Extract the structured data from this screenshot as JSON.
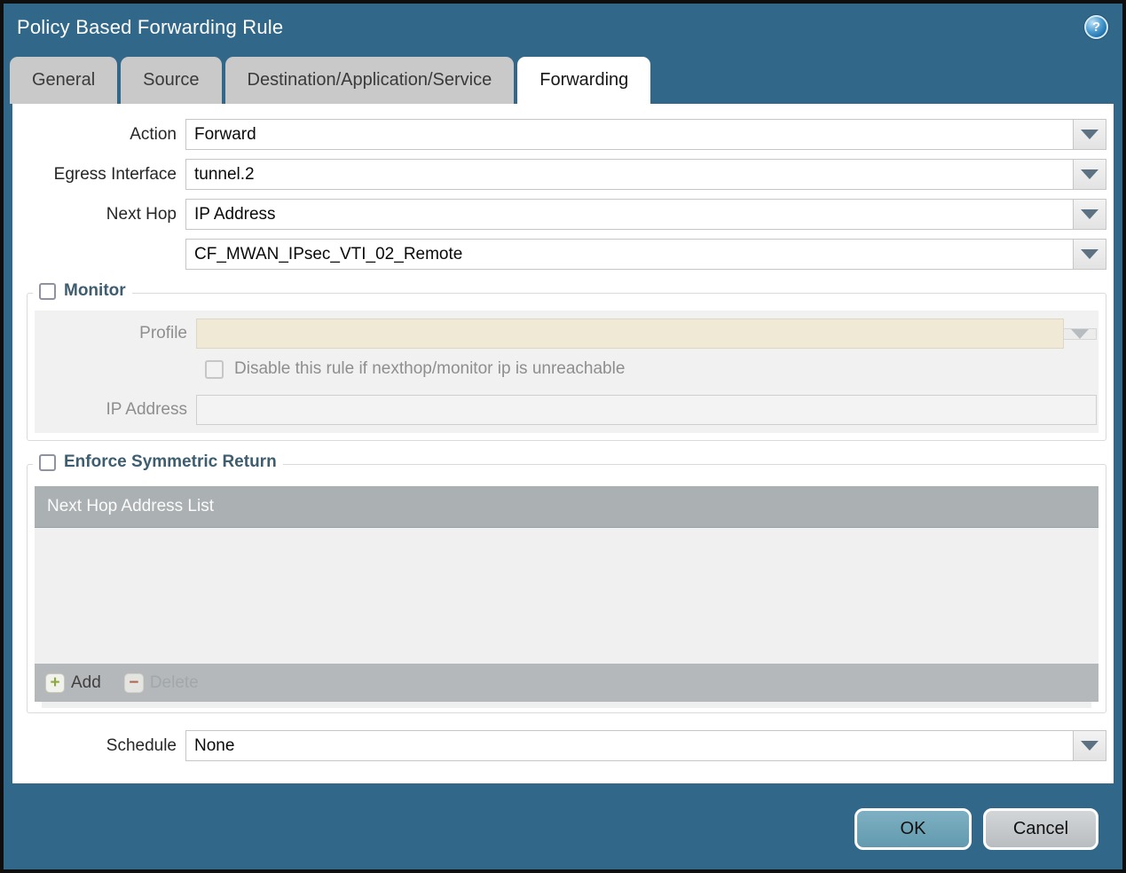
{
  "window": {
    "title": "Policy Based Forwarding Rule"
  },
  "tabs": [
    {
      "label": "General",
      "active": false
    },
    {
      "label": "Source",
      "active": false
    },
    {
      "label": "Destination/Application/Service",
      "active": false
    },
    {
      "label": "Forwarding",
      "active": true
    }
  ],
  "form": {
    "action": {
      "label": "Action",
      "value": "Forward"
    },
    "egress_interface": {
      "label": "Egress Interface",
      "value": "tunnel.2"
    },
    "next_hop": {
      "label": "Next Hop",
      "value": "IP Address"
    },
    "next_hop_value": {
      "value": "CF_MWAN_IPsec_VTI_02_Remote"
    },
    "monitor": {
      "title": "Monitor",
      "checked": false,
      "profile_label": "Profile",
      "profile_value": "",
      "disable_rule_label": "Disable this rule if nexthop/monitor ip is unreachable",
      "disable_rule_checked": false,
      "ip_address_label": "IP Address",
      "ip_address_value": ""
    },
    "enforce": {
      "title": "Enforce Symmetric Return",
      "checked": false,
      "table_header": "Next Hop Address List",
      "rows": [],
      "add_label": "Add",
      "delete_label": "Delete"
    },
    "schedule": {
      "label": "Schedule",
      "value": "None"
    }
  },
  "footer": {
    "ok": "OK",
    "cancel": "Cancel"
  },
  "icons": {
    "help": "?",
    "add_plus": "+",
    "delete_minus": "−"
  },
  "colors": {
    "frame": "#31688a",
    "ok_button": "#6fa2b5",
    "cancel_button": "#c4c8cb",
    "profile_field": "#f0e9d6",
    "add_plus": "#8fa83c",
    "delete_minus": "#b0654f"
  }
}
